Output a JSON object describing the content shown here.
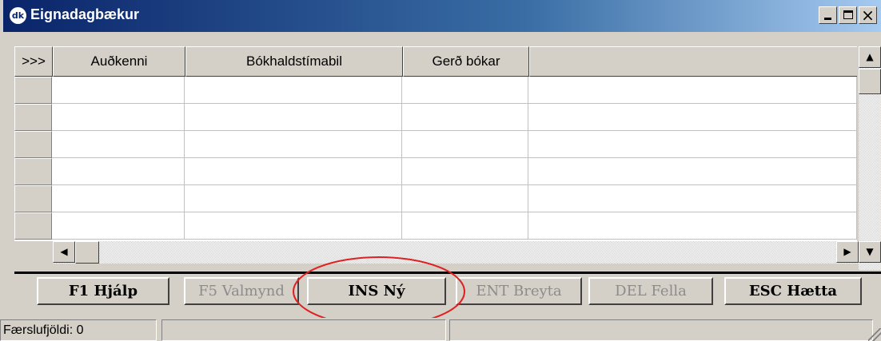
{
  "window": {
    "title": "Eignadagbækur",
    "app_icon_text": "dk",
    "controls": [
      "minimize-icon",
      "maximize-icon",
      "close-icon"
    ],
    "close_glyph": "×"
  },
  "grid": {
    "selector_header": ">>>",
    "columns": [
      "Auðkenni",
      "Bókhaldstímabil",
      "Gerð bókar",
      ""
    ],
    "rows": [
      [
        "",
        "",
        "",
        ""
      ],
      [
        "",
        "",
        "",
        ""
      ],
      [
        "",
        "",
        "",
        ""
      ],
      [
        "",
        "",
        "",
        ""
      ],
      [
        "",
        "",
        "",
        ""
      ],
      [
        "",
        "",
        "",
        ""
      ]
    ],
    "scroll_glyphs": {
      "up": "▲",
      "down": "▼",
      "left": "◀",
      "right": "▶"
    }
  },
  "toolbar": {
    "help": "F1 Hjálp",
    "menu": "F5 Valmynd",
    "new": "INS Ný",
    "edit": "ENT Breyta",
    "delete": "DEL Fella",
    "quit": "ESC Hætta",
    "annotation_color": "#e02020"
  },
  "statusbar": {
    "record_count": "Færslufjöldi: 0",
    "panel2": "",
    "panel3": ""
  }
}
